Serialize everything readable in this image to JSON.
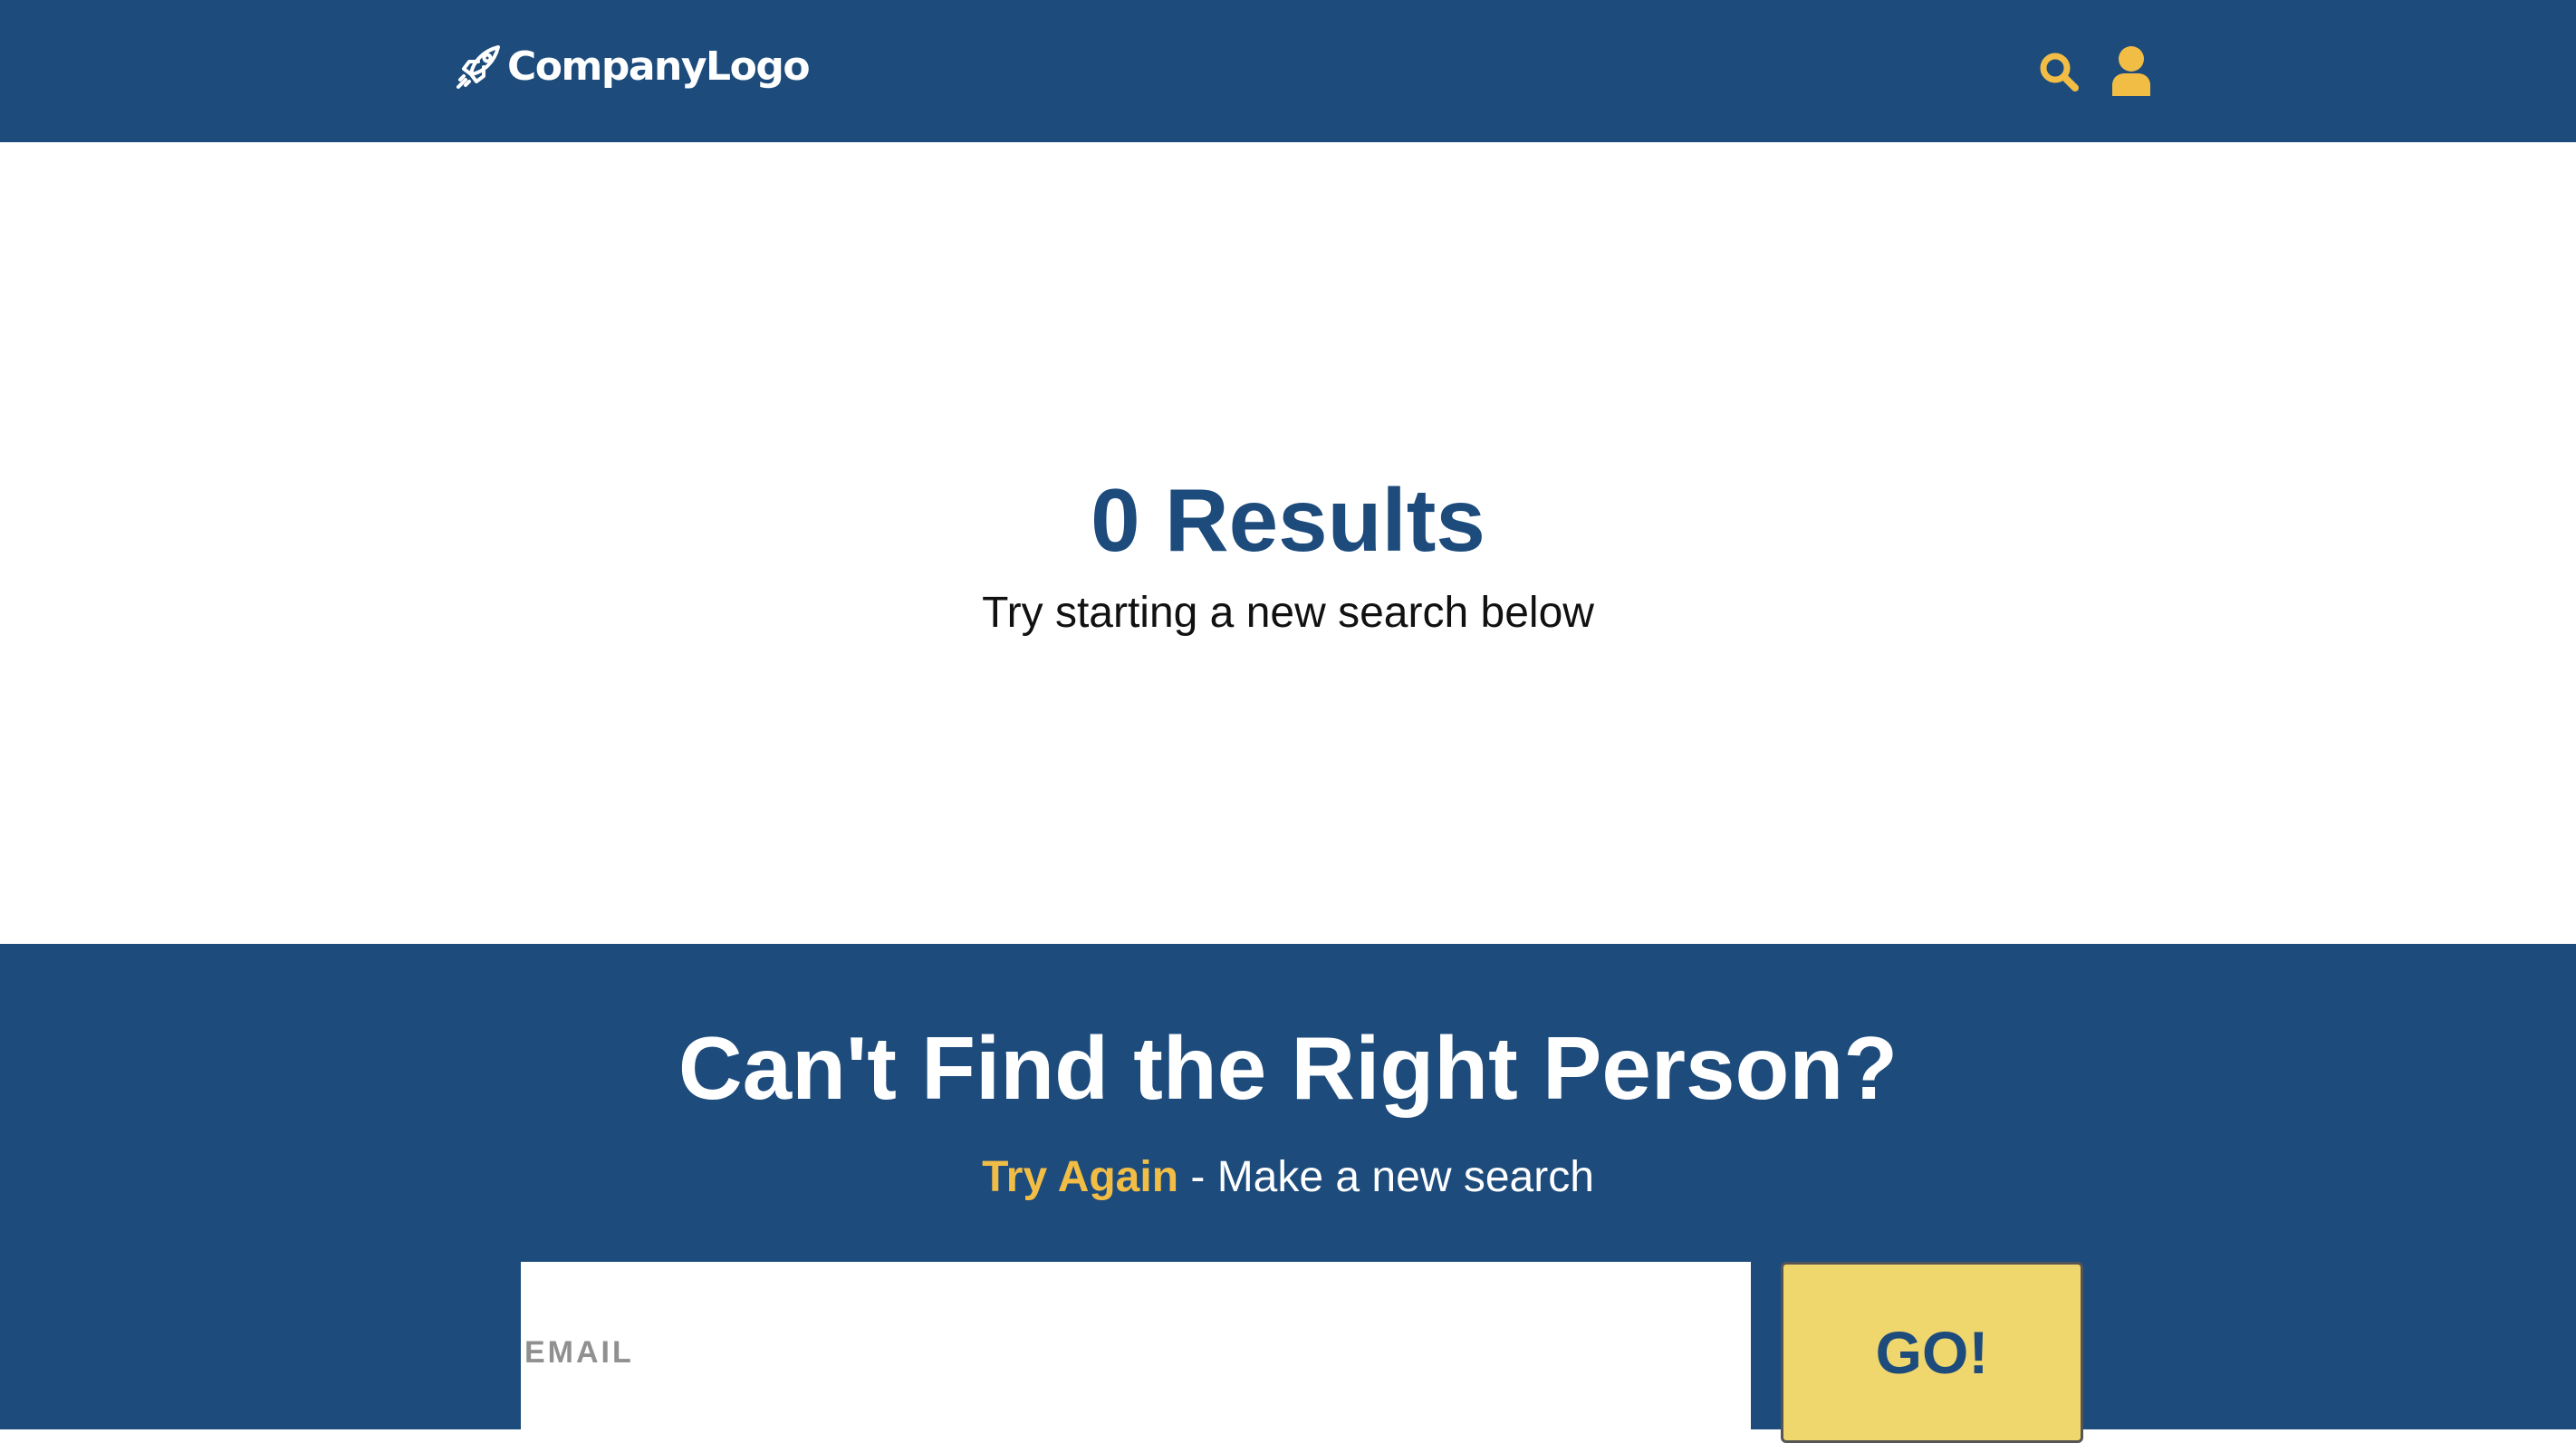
{
  "colors": {
    "primary": "#1c4b7c",
    "accent": "#f2bd45",
    "button": "#efd66d",
    "white": "#ffffff"
  },
  "header": {
    "logo": {
      "icon": "rocket-icon",
      "text": "CompanyLogo"
    },
    "icons": [
      "search-icon",
      "user-icon"
    ]
  },
  "results": {
    "title": "0 Results",
    "subtitle": "Try starting a new search below"
  },
  "cta": {
    "title": "Can't Find the Right Person?",
    "link_text": "Try Again",
    "subtitle_rest": " - Make a new search",
    "email_placeholder": "EMAIL",
    "go_label": "GO!"
  }
}
